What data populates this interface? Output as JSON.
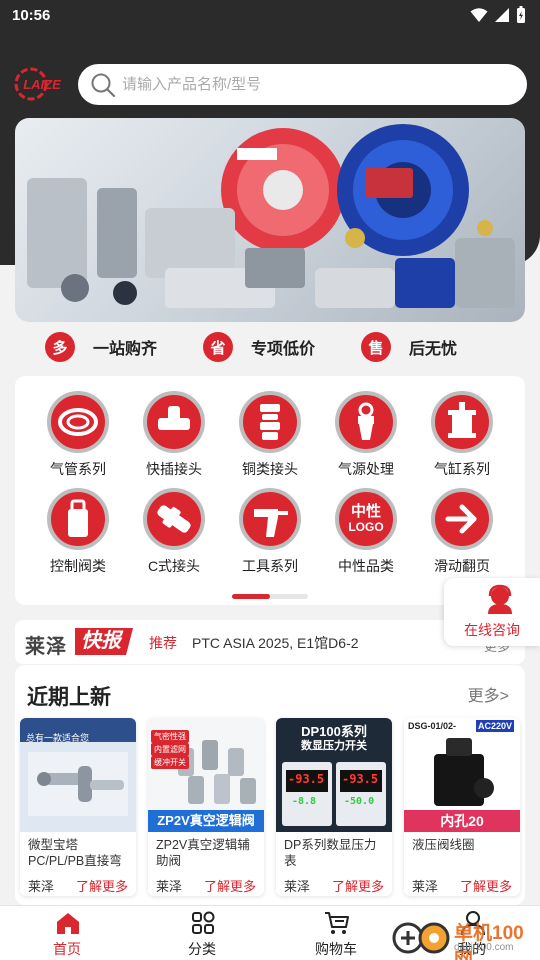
{
  "status_bar": {
    "time": "10:56"
  },
  "brand": {
    "logo_text": "LAIZE",
    "accent_color": "#d9262f"
  },
  "search": {
    "placeholder": "请输入产品名称/型号"
  },
  "features": [
    {
      "badge": "多",
      "label": "一站购齐"
    },
    {
      "badge": "省",
      "label": "专项低价"
    },
    {
      "badge": "售",
      "label": "后无忧"
    }
  ],
  "categories": [
    {
      "label": "气管系列",
      "icon": "hose-coil-icon"
    },
    {
      "label": "快插接头",
      "icon": "tee-fitting-icon"
    },
    {
      "label": "铜类接头",
      "icon": "brass-fitting-icon"
    },
    {
      "label": "气源处理",
      "icon": "air-filter-icon"
    },
    {
      "label": "气缸系列",
      "icon": "cylinder-icon"
    },
    {
      "label": "控制阀类",
      "icon": "valve-icon"
    },
    {
      "label": "C式接头",
      "icon": "c-coupler-icon"
    },
    {
      "label": "工具系列",
      "icon": "air-gun-icon"
    },
    {
      "label": "中性品类",
      "icon": "neutral-logo-icon",
      "icon_text_1": "中性",
      "icon_text_2": "LOGO"
    },
    {
      "label": "滑动翻页",
      "icon": "arrow-right-icon"
    }
  ],
  "floating": {
    "label": "在线咨询"
  },
  "news": {
    "brand": "莱泽",
    "flash": "快报",
    "tag": "推荐",
    "text": "PTC ASIA 2025, E1馆D6-2",
    "more": "更多"
  },
  "recent": {
    "title": "近期上新",
    "more": "更多>",
    "products": [
      {
        "name": "微型宝塔PC/PL/PB直接弯头三...",
        "brand": "莱泽",
        "link": "了解更多",
        "img_caption_1": "总有一款适合您",
        "img_caption_2": ""
      },
      {
        "name": "ZP2V真空逻辑辅助阀",
        "brand": "莱泽",
        "link": "了解更多",
        "img_tags": [
          "气密性强",
          "内置滤网",
          "缓冲开关"
        ],
        "img_caption": "ZP2V真空逻辑阀"
      },
      {
        "name": "DP系列数显压力表",
        "brand": "莱泽",
        "link": "了解更多",
        "img_header_1": "DP100系列",
        "img_header_2": "数显压力开关",
        "img_value_1": "-93.5",
        "img_value_2": "-8.8",
        "img_value_3": "-93.5",
        "img_value_4": "-50.0"
      },
      {
        "name": "液压阀线圈",
        "brand": "莱泽",
        "link": "了解更多",
        "img_model": "DSG-01/02-",
        "img_voltage": "AC220V",
        "img_caption": "内孔20"
      }
    ]
  },
  "tabs": [
    {
      "label": "首页",
      "icon": "home-icon",
      "active": true
    },
    {
      "label": "分类",
      "icon": "grid-icon",
      "active": false
    },
    {
      "label": "购物车",
      "icon": "cart-icon",
      "active": false
    },
    {
      "label": "我的",
      "icon": "user-icon",
      "active": false
    }
  ],
  "watermark": {
    "text": "单机100网",
    "sub": "danji100.com"
  }
}
